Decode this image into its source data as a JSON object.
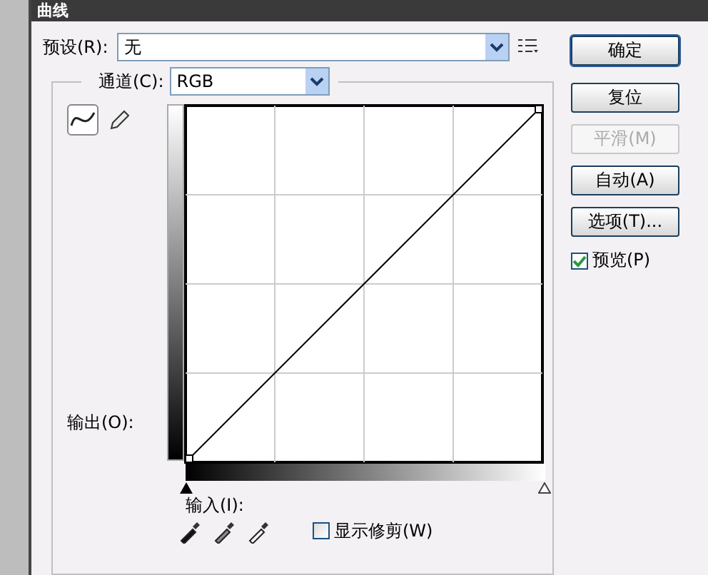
{
  "window": {
    "title": "曲线"
  },
  "preset": {
    "label": "预设(R):",
    "value": "无"
  },
  "channel": {
    "label": "通道(C):",
    "value": "RGB"
  },
  "tools": [
    {
      "kind": "curve",
      "selected": true
    },
    {
      "kind": "pencil",
      "selected": false
    }
  ],
  "output_label": "输出(O):",
  "input_label": "输入(I):",
  "show_clipping": {
    "label": "显示修剪(W)",
    "checked": false
  },
  "buttons": [
    {
      "label": "确定",
      "disabled": false,
      "default": true
    },
    {
      "label": "复位",
      "disabled": false,
      "default": false
    },
    {
      "label": "平滑(M)",
      "disabled": true,
      "default": false
    },
    {
      "label": "自动(A)",
      "disabled": false,
      "default": false
    },
    {
      "label": "选项(T)...",
      "disabled": false,
      "default": false
    }
  ],
  "preview": {
    "label": "预览(P)",
    "checked": true
  }
}
